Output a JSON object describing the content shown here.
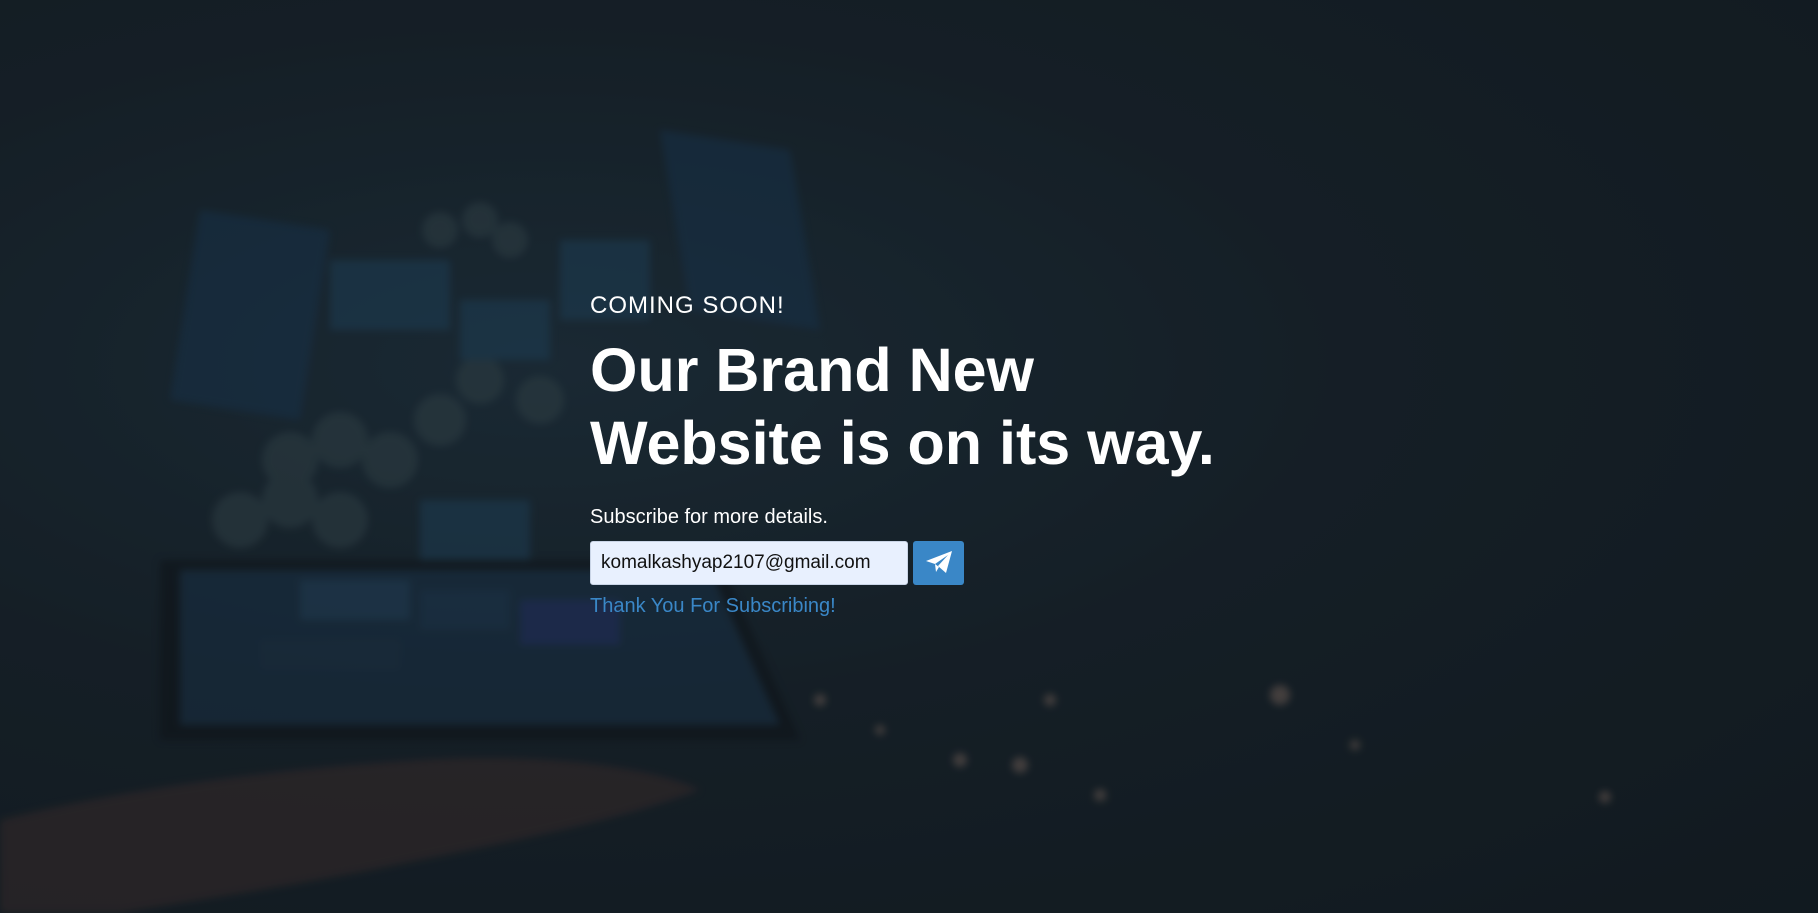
{
  "hero": {
    "eyebrow": "COMING SOON!",
    "headline_line1": "Our Brand New",
    "headline_line2": "Website is on its way.",
    "subtitle": "Subscribe for more details."
  },
  "subscribe_form": {
    "email_value": "komalkashyap2107@gmail.com",
    "submit_icon": "paper-plane-icon",
    "success_message": "Thank You For Subscribing!"
  },
  "colors": {
    "accent": "#3a87c7",
    "background": "#17232b",
    "text": "#ffffff",
    "input_background": "#e8f0fe"
  }
}
